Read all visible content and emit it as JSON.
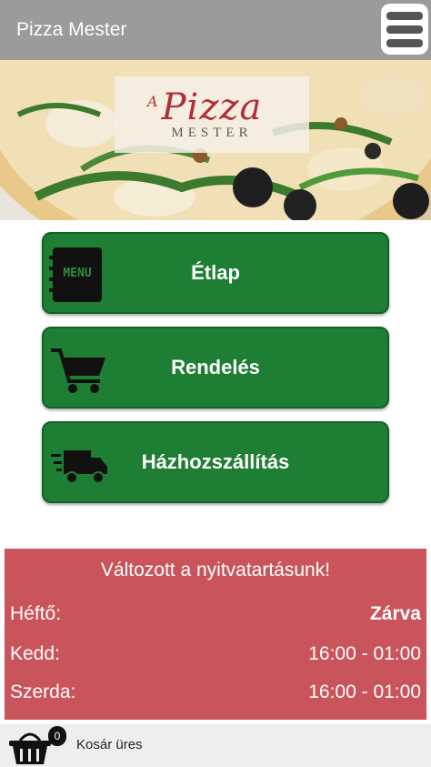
{
  "header": {
    "title": "Pizza Mester",
    "menu_icon": "hamburger-menu-icon"
  },
  "hero": {
    "logo_prefix": "A",
    "logo_main": "Pizza",
    "logo_sub": "MESTER"
  },
  "nav": [
    {
      "label": "Étlap",
      "icon": "menu-board-icon"
    },
    {
      "label": "Rendelés",
      "icon": "shopping-cart-icon"
    },
    {
      "label": "Házhozszállítás",
      "icon": "delivery-truck-icon"
    }
  ],
  "hours": {
    "title": "Változott a nyitvatartásunk!",
    "rows": [
      {
        "day": "Héftő:",
        "time": "Zárva"
      },
      {
        "day": "Kedd:",
        "time": "16:00 - 01:00"
      },
      {
        "day": "Szerda:",
        "time": "16:00 - 01:00"
      }
    ]
  },
  "cart": {
    "count": "0",
    "status": "Kosár üres",
    "icon": "basket-icon"
  },
  "colors": {
    "topbar": "#9b9b9b",
    "button": "#1e7e34",
    "hours_bg": "#c9545b",
    "logo": "#b02e38"
  }
}
